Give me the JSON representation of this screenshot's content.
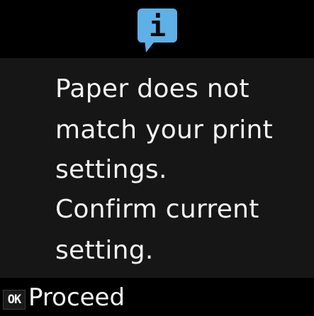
{
  "dialog": {
    "icon": "info-speech-bubble-icon",
    "icon_glyph": "i",
    "message_lines": [
      "Paper does not",
      "match your print",
      "settings.",
      "Confirm current",
      "setting."
    ]
  },
  "footer": {
    "ok_key_label": "OK",
    "action_label": "Proceed"
  },
  "colors": {
    "background": "#000000",
    "panel": "#161616",
    "text": "#f4f4f4",
    "icon_accent": "#5fb0e6"
  }
}
